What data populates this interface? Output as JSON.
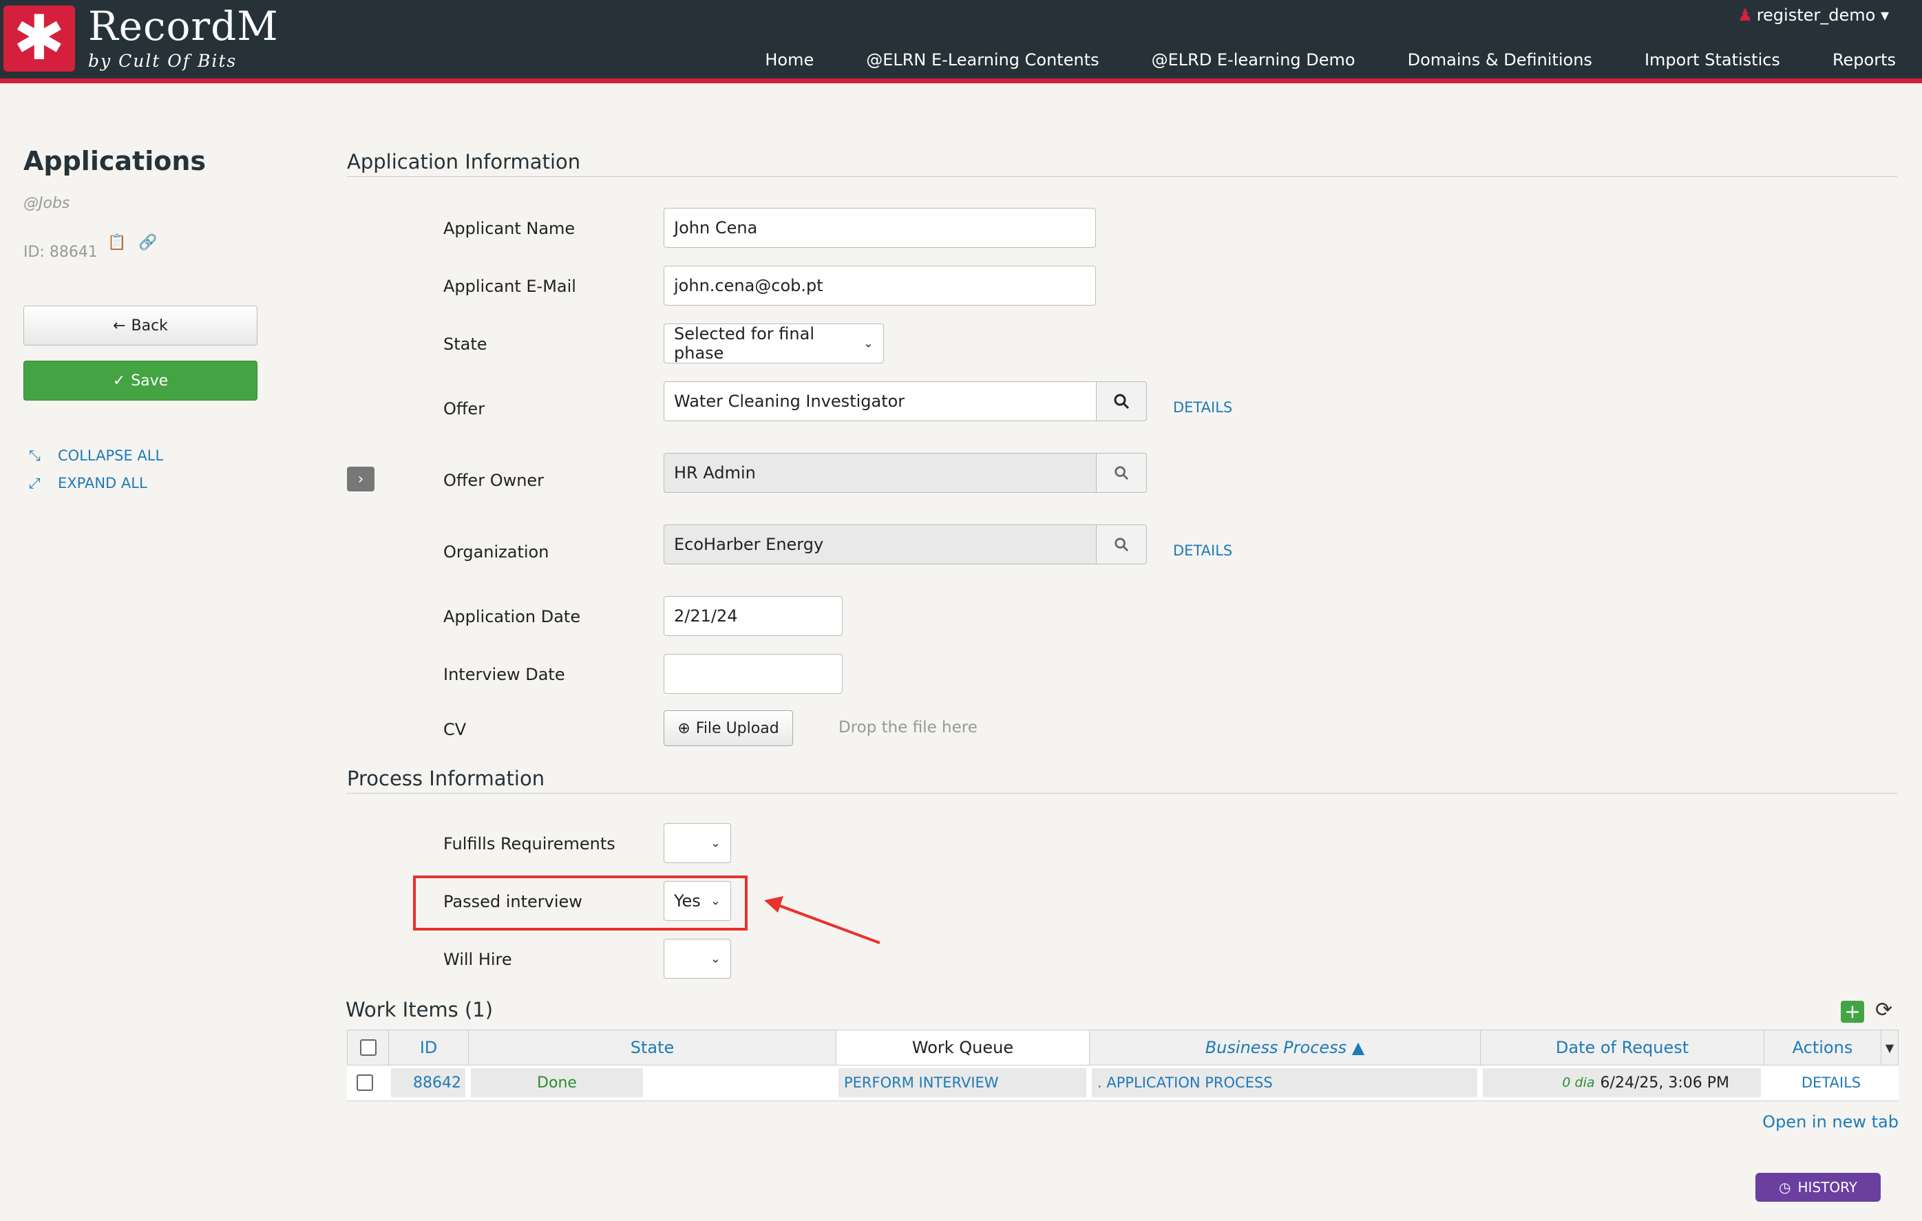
{
  "header": {
    "logo_symbol": "✱",
    "logo_title": "RecordM",
    "logo_subtitle": "by Cult Of Bits",
    "user": "register_demo ▾",
    "nav": [
      "Home",
      "@ELRN E-Learning Contents",
      "@ELRD E-learning Demo",
      "Domains & Definitions",
      "Import Statistics",
      "Reports"
    ],
    "accent_color": "#d4203c"
  },
  "sidebar": {
    "title": "Applications",
    "subtitle": "@Jobs",
    "id_label": "ID: 88641",
    "back_label": "Back",
    "save_label": "Save",
    "collapse_all": "COLLAPSE ALL",
    "expand_all": "EXPAND ALL"
  },
  "application_info": {
    "section_title": "Application Information",
    "applicant_name_label": "Applicant Name",
    "applicant_name": "John Cena",
    "applicant_email_label": "Applicant E-Mail",
    "applicant_email": "john.cena@cob.pt",
    "state_label": "State",
    "state_value": "Selected for final phase",
    "offer_label": "Offer",
    "offer_value": "Water Cleaning Investigator",
    "offer_owner_label": "Offer Owner",
    "offer_owner_value": "HR Admin",
    "organization_label": "Organization",
    "organization_value": "EcoHarber Energy",
    "details_label": "DETAILS",
    "application_date_label": "Application Date",
    "application_date": "2/21/24",
    "interview_date_label": "Interview Date",
    "interview_date": "",
    "cv_label": "CV",
    "file_upload_label": "File Upload",
    "drop_text": "Drop the file here"
  },
  "process_info": {
    "section_title": "Process Information",
    "fulfills_label": "Fulfills Requirements",
    "fulfills_value": "",
    "passed_label": "Passed interview",
    "passed_value": "Yes",
    "will_hire_label": "Will Hire",
    "will_hire_value": ""
  },
  "work_items": {
    "title": "Work Items (1)",
    "columns": [
      "ID",
      "State",
      "Work Queue",
      "Business Process ▲",
      "Date of Request",
      "Actions"
    ],
    "rows": [
      {
        "id": "88642",
        "state": "Done",
        "work_queue": "PERFORM INTERVIEW",
        "business_process": ". APPLICATION PROCESS",
        "date_age": "0 dia",
        "date": "6/24/25, 3:06 PM",
        "action": "DETAILS"
      }
    ],
    "open_new_tab": "Open in new tab"
  },
  "history_label": "HISTORY"
}
